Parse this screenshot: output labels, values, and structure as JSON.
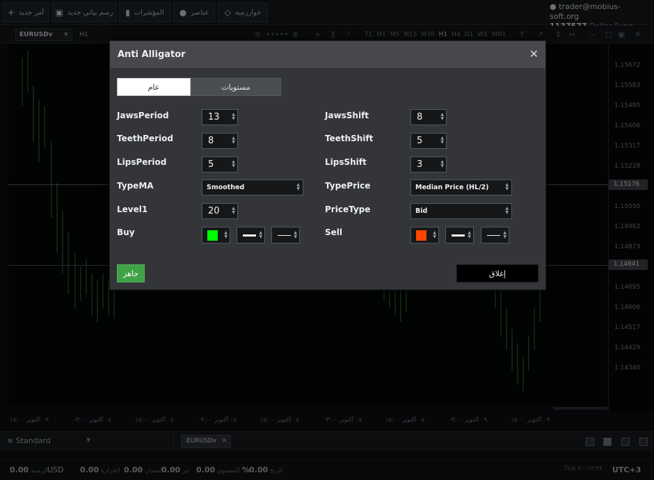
{
  "toolbar": {
    "new_order": "أمر جديد",
    "new_chart": "رسم بياني جديد",
    "indicators": "المؤشرات",
    "objects": "عناصر",
    "algorithms": "خوارزمية"
  },
  "account": {
    "email": "trader@mobius-soft.org",
    "number": "1137577",
    "fund": "Dollar Fund"
  },
  "chart_toolbar": {
    "symbol": "EURUSDv",
    "timeframe": "H1",
    "timeframes": [
      "T1",
      "M1",
      "M5",
      "M15",
      "M30",
      "H1",
      "H4",
      "D1",
      "W1",
      "MN1"
    ]
  },
  "price_axis": {
    "labels": [
      "1.15672",
      "1.15583",
      "1.15495",
      "1.15406",
      "1.15317",
      "1.15228",
      "1.15139",
      "1.15050",
      "1.14962",
      "1.14873",
      "1.14784",
      "1.14695",
      "1.14606",
      "1.14517",
      "1.14429",
      "1.14340"
    ],
    "badge_top": "1.15176",
    "badge_bottom": "1.14841"
  },
  "time_axis": {
    "labels": [
      "٠٣ أكتوبر ١٥:٠٠",
      "٠٤ أكتوبر ٠٣:٠٠",
      "٠٤ أكتوبر ١٥:٠٠",
      "٠٥ أكتوبر ٠٣:٠٠",
      "٠٥ أكتوبر ١٥:٠٠",
      "٠٨ أكتوبر ٠٣:٠٠",
      "٠٨ أكتوبر ١٥:٠٠",
      "٠٩ أكتوبر ٠٣:٠٠",
      "٠٩ أكتوبر ١٥:٠٠"
    ]
  },
  "dialog": {
    "title": "Anti Alligator",
    "tabs": [
      "عام",
      "مستويات"
    ],
    "params": {
      "jaws_period": {
        "label": "JawsPeriod",
        "value": "13"
      },
      "jaws_shift": {
        "label": "JawsShift",
        "value": "8"
      },
      "teeth_period": {
        "label": "TeethPeriod",
        "value": "8"
      },
      "teeth_shift": {
        "label": "TeethShift",
        "value": "5"
      },
      "lips_period": {
        "label": "LipsPeriod",
        "value": "5"
      },
      "lips_shift": {
        "label": "LipsShift",
        "value": "3"
      },
      "type_ma": {
        "label": "TypeMA",
        "value": "Smoothed"
      },
      "type_price": {
        "label": "TypePrice",
        "value": "Median Price (HL/2)"
      },
      "level1": {
        "label": "Level1",
        "value": "20"
      },
      "price_type": {
        "label": "PriceType",
        "value": "Bid"
      },
      "buy": {
        "label": "Buy",
        "color": "#00ff00"
      },
      "sell": {
        "label": "Sell",
        "color": "#ff4500"
      }
    },
    "ok_label": "جاهز",
    "close_label": "إغلاق"
  },
  "tabbar": {
    "template": "Standard",
    "symbol_tab": "EURUSDv"
  },
  "status": {
    "balance_value": "0.00",
    "balance_currency": "USD",
    "balance_label": "الرصيد",
    "equity_value": "0.00",
    "equity_label": "الحرارة",
    "used_margin_value": "0.00",
    "used_margin_label": "الضمان",
    "free_margin_value": "0.00",
    "free_margin_label": "حر",
    "level_value": "%",
    "level_label": "المستوى",
    "profit_value": "0.00",
    "profit_label": "الربح",
    "tick_label": "Tick",
    "tick_time": "٢٠:١٧:٣٨",
    "timezone": "UTC+3"
  }
}
